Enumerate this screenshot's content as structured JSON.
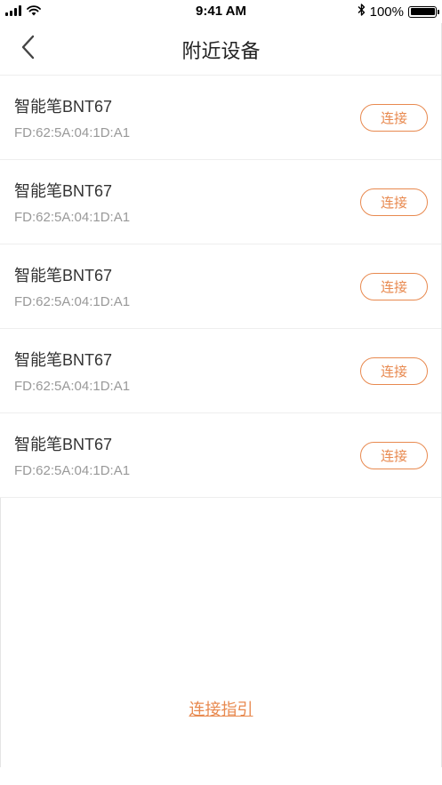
{
  "status_bar": {
    "time": "9:41 AM",
    "battery_percent": "100%",
    "battery_level": 1.0
  },
  "nav": {
    "title": "附近设备",
    "back_icon": "chevron-left-icon"
  },
  "devices": [
    {
      "name": "智能笔BNT67",
      "mac": "FD:62:5A:04:1D:A1",
      "connect_label": "连接"
    },
    {
      "name": "智能笔BNT67",
      "mac": "FD:62:5A:04:1D:A1",
      "connect_label": "连接"
    },
    {
      "name": "智能笔BNT67",
      "mac": "FD:62:5A:04:1D:A1",
      "connect_label": "连接"
    },
    {
      "name": "智能笔BNT67",
      "mac": "FD:62:5A:04:1D:A1",
      "connect_label": "连接"
    },
    {
      "name": "智能笔BNT67",
      "mac": "FD:62:5A:04:1D:A1",
      "connect_label": "连接"
    }
  ],
  "guide_link": "连接指引",
  "colors": {
    "accent": "#e8894f",
    "secondary_text": "#999999",
    "divider": "#eeeeee"
  }
}
